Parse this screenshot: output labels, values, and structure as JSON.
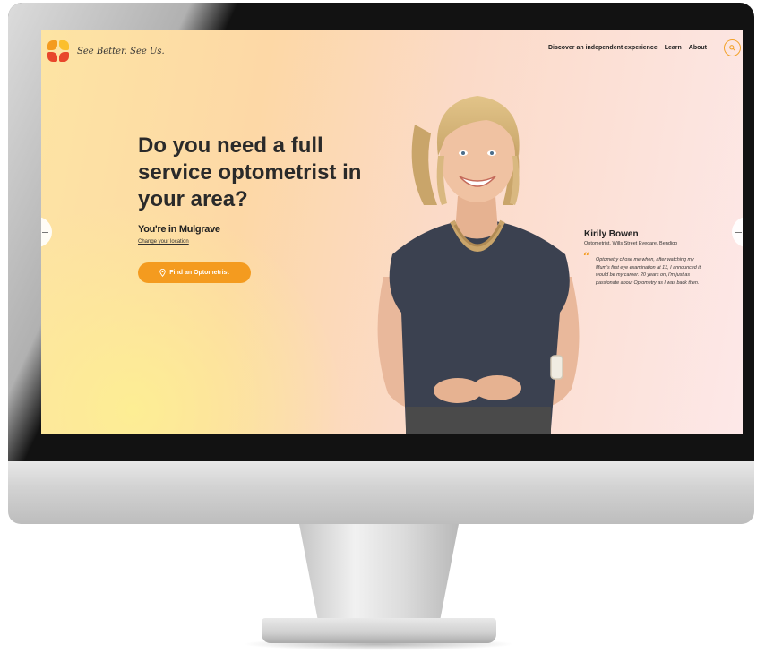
{
  "site": {
    "tagline": "See Better. See Us.",
    "brand_colors": {
      "accent": "#f49b1f",
      "logo_orange": "#f49b1f",
      "logo_red": "#e8462b",
      "logo_yellow": "#fbbf2d"
    }
  },
  "nav": {
    "items": [
      {
        "label": "Discover an independent experience"
      },
      {
        "label": "Learn"
      },
      {
        "label": "About"
      }
    ]
  },
  "hero": {
    "headline": "Do you need a full service optometrist in your area?",
    "location_text": "You're in Mulgrave",
    "change_location_label": "Change your location",
    "cta_label": "Find an Optometrist"
  },
  "testimonial": {
    "name": "Kirily Bowen",
    "role": "Optometrist, Wills Street Eyecare, Bendigo",
    "quote_mark": "“",
    "quote": "Optometry chose me when, after watching my Mum's first eye examination at 13, I announced it would be my career. 20 years on, I'm just as passionate about Optometry as I was back then."
  },
  "icons": {
    "search": "search-icon",
    "location_pin": "location-pin-icon",
    "logo": "butterfly-logo-icon"
  }
}
